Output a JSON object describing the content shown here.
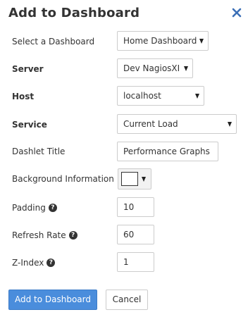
{
  "dialog": {
    "title": "Add to Dashboard"
  },
  "fields": {
    "dashboard": {
      "label": "Select a Dashboard",
      "value": "Home Dashboard"
    },
    "server": {
      "label": "Server",
      "value": "Dev NagiosXI"
    },
    "host": {
      "label": "Host",
      "value": "localhost"
    },
    "service": {
      "label": "Service",
      "value": "Current Load"
    },
    "dashlet_title": {
      "label": "Dashlet Title",
      "value": "Performance Graphs"
    },
    "background": {
      "label": "Background Information",
      "color": "#ffffff"
    },
    "padding": {
      "label": "Padding",
      "value": "10"
    },
    "refresh_rate": {
      "label": "Refresh Rate",
      "value": "60"
    },
    "z_index": {
      "label": "Z-Index",
      "value": "1"
    }
  },
  "help_glyph": "?",
  "buttons": {
    "add": "Add to Dashboard",
    "cancel": "Cancel"
  },
  "colors": {
    "primary": "#4a8ddc",
    "close_icon": "#3b6fb6"
  }
}
